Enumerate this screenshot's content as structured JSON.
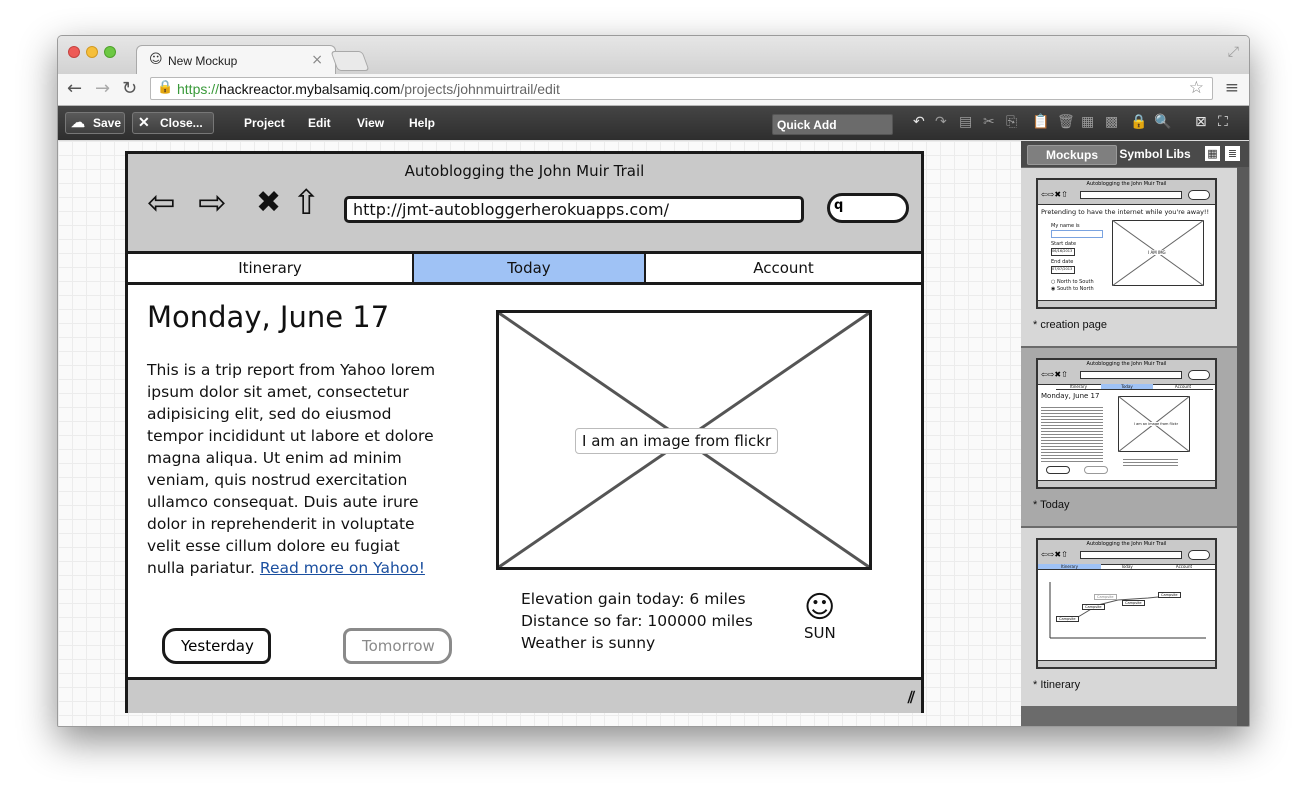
{
  "browser": {
    "tab_title": "New Mockup",
    "tab_close": "×",
    "url_scheme": "https://",
    "url_host": "hackreactor.mybalsamiq.com",
    "url_path": "/projects/johnmuirtrail/edit"
  },
  "toolbar": {
    "save_label": "Save",
    "close_label": "Close...",
    "menus": [
      "Project",
      "Edit",
      "View",
      "Help"
    ],
    "quick_add_placeholder": "Quick Add"
  },
  "mockup": {
    "title": "Autoblogging the John Muir Trail",
    "url": "http://jmt-autobloggerherokuapps.com/",
    "search_glyph": "q",
    "tabs": [
      "Itinerary",
      "Today",
      "Account"
    ],
    "selected_tab": "Today",
    "date_heading": "Monday, June 17",
    "paragraph": "This is a trip report from Yahoo lorem ipsum dolor sit amet, consectetur adipisicing elit, sed do eiusmod tempor incididunt ut labore et dolore magna aliqua. Ut enim ad minim veniam, quis nostrud exercitation ullamco consequat. Duis aute irure dolor in reprehenderit in voluptate velit esse cillum dolore eu fugiat nulla pariatur.",
    "link_text": "Read more on Yahoo!",
    "image_caption": "I am an image from flickr",
    "stats": [
      "Elevation gain today: 6 miles",
      "Distance so far: 100000 miles",
      "Weather is sunny"
    ],
    "weather_label": "SUN",
    "prev_button": "Yesterday",
    "next_button": "Tomorrow"
  },
  "panel": {
    "tabs": [
      "Mockups",
      "Symbol Libs"
    ],
    "cards": [
      {
        "label": "* creation page",
        "thumb_title": "Autoblogging the John Muir Trail",
        "thumb_heading": "Pretending to have the internet while you're away!!",
        "thumb_fields": [
          "My name is",
          "Start date",
          "End date"
        ],
        "thumb_dates": [
          "06/16/2013",
          "07/07/2013"
        ],
        "thumb_radios": [
          "North to South",
          "South to North"
        ],
        "thumb_image": "I AM IMG"
      },
      {
        "label": "* Today",
        "thumb_title": "Autoblogging the John Muir Trail",
        "thumb_heading": "Monday, June 17",
        "thumb_image": "I am an image from flickr",
        "thumb_tabs": [
          "Itinerary",
          "Today",
          "Account"
        ]
      },
      {
        "label": "* Itinerary",
        "thumb_title": "Autoblogging the John Muir Trail",
        "thumb_tabs": [
          "Itinerary",
          "Today",
          "Account"
        ],
        "thumb_nodes": [
          "Campsite",
          "Campsite",
          "Campsite",
          "Campsite",
          "Campsite"
        ]
      }
    ]
  },
  "colors": {
    "selected_tab": "#9fc2f5",
    "link": "#1b4f9f",
    "toolbar_bg": "#3a3a3a",
    "panel_bg": "#6b6b6b"
  }
}
